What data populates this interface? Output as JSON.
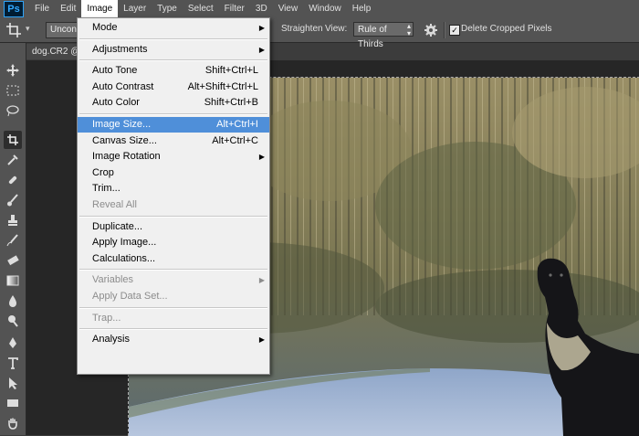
{
  "app": {
    "logo": "Ps"
  },
  "menubar": {
    "items": [
      "File",
      "Edit",
      "Image",
      "Layer",
      "Type",
      "Select",
      "Filter",
      "3D",
      "View",
      "Window",
      "Help"
    ],
    "active": "Image"
  },
  "options": {
    "ratio_value": "Uncons",
    "straighten_label": "Straighten",
    "view_label": "View:",
    "view_value": "Rule of Thirds",
    "delete_cropped_label": "Delete Cropped Pixels",
    "delete_cropped_checked": true
  },
  "document": {
    "tab_title": "dog.CR2 @"
  },
  "image_menu": {
    "items": [
      {
        "label": "Mode",
        "submenu": true
      },
      {
        "sep": true
      },
      {
        "label": "Adjustments",
        "submenu": true
      },
      {
        "sep": true
      },
      {
        "label": "Auto Tone",
        "shortcut": "Shift+Ctrl+L"
      },
      {
        "label": "Auto Contrast",
        "shortcut": "Alt+Shift+Ctrl+L"
      },
      {
        "label": "Auto Color",
        "shortcut": "Shift+Ctrl+B"
      },
      {
        "sep": true
      },
      {
        "label": "Image Size...",
        "shortcut": "Alt+Ctrl+I",
        "highlighted": true
      },
      {
        "label": "Canvas Size...",
        "shortcut": "Alt+Ctrl+C"
      },
      {
        "label": "Image Rotation",
        "submenu": true
      },
      {
        "label": "Crop"
      },
      {
        "label": "Trim..."
      },
      {
        "label": "Reveal All",
        "disabled": true
      },
      {
        "sep": true
      },
      {
        "label": "Duplicate..."
      },
      {
        "label": "Apply Image..."
      },
      {
        "label": "Calculations..."
      },
      {
        "sep": true
      },
      {
        "label": "Variables",
        "submenu": true,
        "disabled": true
      },
      {
        "label": "Apply Data Set...",
        "disabled": true
      },
      {
        "sep": true
      },
      {
        "label": "Trap...",
        "disabled": true
      },
      {
        "sep": true
      },
      {
        "label": "Analysis",
        "submenu": true
      }
    ]
  },
  "colors": {
    "menu_highlight": "#4f8fd9",
    "panel": "#535353",
    "workspace": "#262626"
  }
}
